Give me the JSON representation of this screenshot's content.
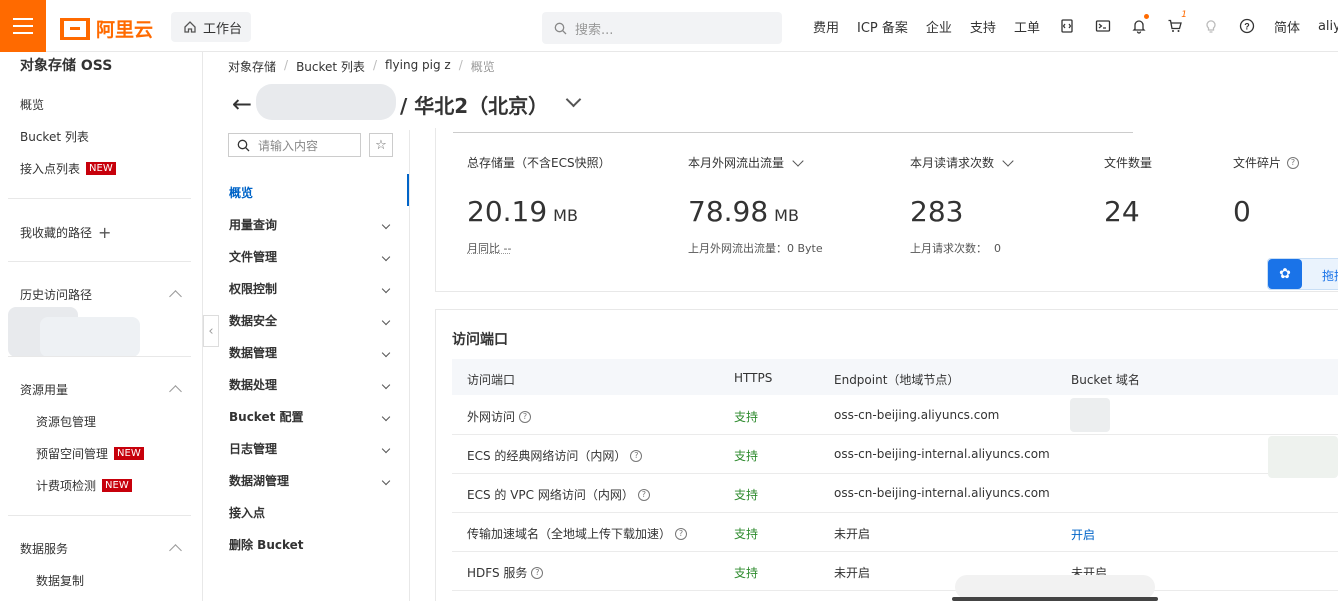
{
  "topbar": {
    "logo_text": "阿里云",
    "workbench_label": "工作台",
    "search_placeholder": "搜索...",
    "nav": [
      "费用",
      "ICP 备案",
      "企业",
      "支持",
      "工单"
    ],
    "cart_count": "1",
    "lang": "简体",
    "user": "aliyun"
  },
  "sidebar": {
    "title": "对象存储 OSS",
    "items": [
      "概览",
      "Bucket 列表",
      "接入点列表"
    ],
    "new_badge": "NEW",
    "favorites_label": "我收藏的路径",
    "history_label": "历史访问路径",
    "resources_label": "资源用量",
    "resource_items": [
      "资源包管理",
      "预留空间管理",
      "计费项检测"
    ],
    "data_service_label": "数据服务",
    "data_service_items": [
      "数据复制"
    ]
  },
  "breadcrumb": [
    "对象存储",
    "Bucket 列表",
    "flying pig z",
    "概览"
  ],
  "page_title": "/ 华北2（北京）",
  "subnav": {
    "search_placeholder": "请输入内容",
    "items": [
      {
        "label": "概览",
        "active": true,
        "expandable": false
      },
      {
        "label": "用量查询",
        "active": false,
        "expandable": true
      },
      {
        "label": "文件管理",
        "active": false,
        "expandable": true
      },
      {
        "label": "权限控制",
        "active": false,
        "expandable": true
      },
      {
        "label": "数据安全",
        "active": false,
        "expandable": true
      },
      {
        "label": "数据管理",
        "active": false,
        "expandable": true
      },
      {
        "label": "数据处理",
        "active": false,
        "expandable": true
      },
      {
        "label": "Bucket 配置",
        "active": false,
        "expandable": true
      },
      {
        "label": "日志管理",
        "active": false,
        "expandable": true
      },
      {
        "label": "数据湖管理",
        "active": false,
        "expandable": true
      },
      {
        "label": "接入点",
        "active": false,
        "expandable": false
      },
      {
        "label": "删除 Bucket",
        "active": false,
        "expandable": false
      }
    ]
  },
  "stats": [
    {
      "label": "总存储量（不含ECS快照）",
      "value": "20.19",
      "unit": "MB",
      "sub": "月同比 --"
    },
    {
      "label": "本月外网流出流量",
      "value": "78.98",
      "unit": "MB",
      "sub": "上月外网流出流量：0 Byte"
    },
    {
      "label": "本月读请求次数",
      "value": "283",
      "unit": "",
      "sub": "上月请求次数：  0"
    },
    {
      "label": "文件数量",
      "value": "24",
      "unit": "",
      "sub": ""
    },
    {
      "label": "文件碎片",
      "value": "0",
      "unit": "",
      "sub": ""
    }
  ],
  "float_button_text": "拖拽",
  "access": {
    "title": "访问端口",
    "headers": [
      "访问端口",
      "HTTPS",
      "Endpoint（地域节点）",
      "Bucket 域名"
    ],
    "rows": [
      {
        "name": "外网访问",
        "https": "支持",
        "endpoint": "oss-cn-beijing.aliyuncs.com",
        "domain": ""
      },
      {
        "name": "ECS 的经典网络访问（内网）",
        "https": "支持",
        "endpoint": "oss-cn-beijing-internal.aliyuncs.com",
        "domain": ""
      },
      {
        "name": "ECS 的 VPC 网络访问（内网）",
        "https": "支持",
        "endpoint": "oss-cn-beijing-internal.aliyuncs.com",
        "domain": ""
      },
      {
        "name": "传输加速域名（全地域上传下载加速）",
        "https": "支持",
        "endpoint": "未开启",
        "domain": "开启"
      },
      {
        "name": "HDFS 服务",
        "https": "支持",
        "endpoint": "未开启",
        "domain": "未开启"
      }
    ]
  },
  "colors": {
    "brand": "#ff6a00",
    "link": "#0064c8",
    "success": "#2e8b2e",
    "badge": "#c7000b"
  }
}
